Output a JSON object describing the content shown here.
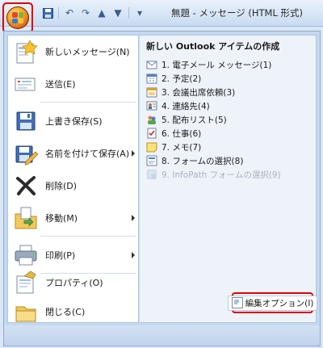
{
  "window": {
    "title": "無題 - メッセージ (HTML 形式)"
  },
  "qat": {
    "icons": [
      "save-icon",
      "undo-icon",
      "redo-icon",
      "up-arrow-icon",
      "down-arrow-icon",
      "customize-icon"
    ]
  },
  "menu": {
    "commands": [
      {
        "label": "新しいメッセージ(N)",
        "icon": "new-message-icon",
        "submenu": false
      },
      {
        "label": "送信(E)",
        "icon": "send-icon",
        "submenu": false
      },
      {
        "label": "上書き保存(S)",
        "icon": "save-icon",
        "submenu": false
      },
      {
        "label": "名前を付けて保存(A)",
        "icon": "save-as-icon",
        "submenu": true
      },
      {
        "label": "削除(D)",
        "icon": "delete-icon",
        "submenu": false
      },
      {
        "label": "移動(M)",
        "icon": "move-icon",
        "submenu": true
      },
      {
        "label": "印刷(P)",
        "icon": "print-icon",
        "submenu": true
      },
      {
        "label": "プロパティ(O)",
        "icon": "properties-icon",
        "submenu": false
      },
      {
        "label": "閉じる(C)",
        "icon": "close-folder-icon",
        "submenu": false
      }
    ],
    "new_items_title": "新しい Outlook アイテムの作成",
    "new_items": [
      {
        "label": "1. 電子メール メッセージ(1)",
        "icon": "email-icon",
        "enabled": true
      },
      {
        "label": "2. 予定(2)",
        "icon": "calendar-icon",
        "enabled": true
      },
      {
        "label": "3. 会議出席依頼(3)",
        "icon": "meeting-icon",
        "enabled": true
      },
      {
        "label": "4. 連絡先(4)",
        "icon": "contact-icon",
        "enabled": true
      },
      {
        "label": "5. 配布リスト(5)",
        "icon": "distribution-list-icon",
        "enabled": true
      },
      {
        "label": "6. 仕事(6)",
        "icon": "task-icon",
        "enabled": true
      },
      {
        "label": "7. メモ(7)",
        "icon": "note-icon",
        "enabled": true
      },
      {
        "label": "8. フォームの選択(8)",
        "icon": "form-icon",
        "enabled": true
      },
      {
        "label": "9. InfoPath フォームの選択(9)",
        "icon": "infopath-icon",
        "enabled": false
      }
    ],
    "editor_options_label": "編集オプション(I)"
  }
}
